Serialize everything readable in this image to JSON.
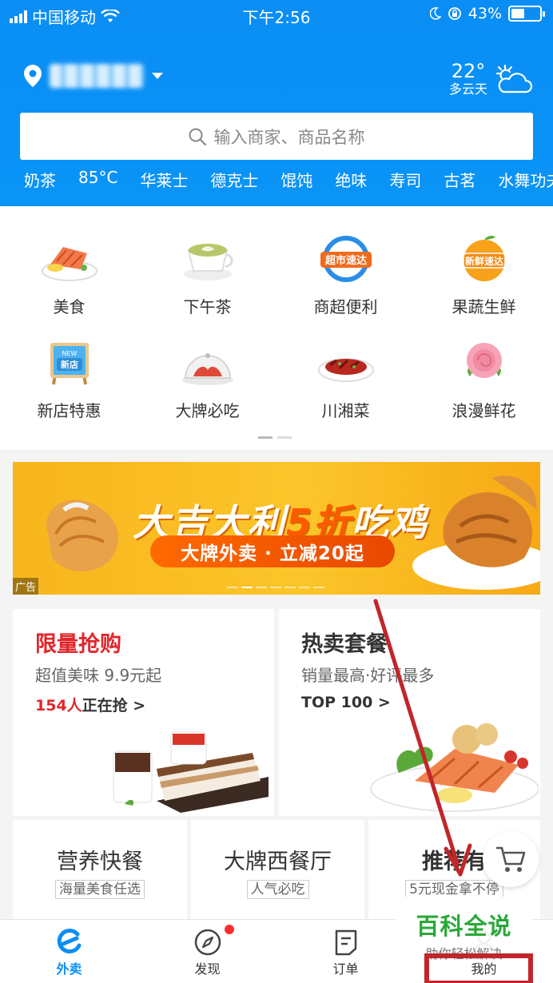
{
  "status_bar": {
    "carrier": "中国移动",
    "time": "下午2:56",
    "battery": "43%",
    "battery_level": 0.43
  },
  "header": {
    "weather": {
      "temp": "22°",
      "desc": "多云天"
    },
    "search": {
      "placeholder": "输入商家、商品名称"
    },
    "hot_words": [
      "奶茶",
      "85°C",
      "华莱士",
      "德克士",
      "馄饨",
      "绝味",
      "寿司",
      "古茗",
      "水舞功夫"
    ]
  },
  "categories": [
    {
      "label": "美食",
      "icon": "salmon-plate-icon"
    },
    {
      "label": "下午茶",
      "icon": "latte-cup-icon"
    },
    {
      "label": "商超便利",
      "icon": "supermarket-express-icon",
      "badge": "超市速达"
    },
    {
      "label": "果蔬生鲜",
      "icon": "orange-fresh-icon",
      "badge": "新鲜速达"
    },
    {
      "label": "新店特惠",
      "icon": "new-store-sign-icon",
      "badge": "新店",
      "badge_top": "NEW"
    },
    {
      "label": "大牌必吃",
      "icon": "cloche-dish-icon"
    },
    {
      "label": "川湘菜",
      "icon": "spicy-dish-icon"
    },
    {
      "label": "浪漫鲜花",
      "icon": "rose-icon"
    }
  ],
  "banner": {
    "title_a": "大吉大利",
    "title_b": "5折",
    "title_c": "吃鸡",
    "pill": "大牌外卖 · 立减20起",
    "ad_label": "广告"
  },
  "promo": {
    "flash": {
      "title": "限量抢购",
      "subtitle": "超值美味 9.9元起",
      "count": "154人",
      "count_suffix": "正在抢 >"
    },
    "hot": {
      "title": "热卖套餐",
      "subtitle": "销量最高·好评最多",
      "link": "TOP 100 >"
    }
  },
  "small_cards": [
    {
      "title": "营养快餐",
      "tag": "海量美食任选"
    },
    {
      "title": "大牌西餐厅",
      "tag": "人气必吃"
    },
    {
      "title": "推荐有",
      "tag": "5元现金拿不停"
    }
  ],
  "tabs": [
    {
      "label": "外卖",
      "icon": "eleme-icon",
      "active": true
    },
    {
      "label": "发现",
      "icon": "compass-icon"
    },
    {
      "label": "订单",
      "icon": "order-icon"
    },
    {
      "label": "我的",
      "icon": "profile-icon"
    }
  ],
  "watermark": {
    "main": "百科全说",
    "sub": "助你轻松解决"
  },
  "colors": {
    "brand_blue": "#0a8ef5",
    "flash_red": "#e0262c",
    "annotation_red": "#c0262a"
  }
}
